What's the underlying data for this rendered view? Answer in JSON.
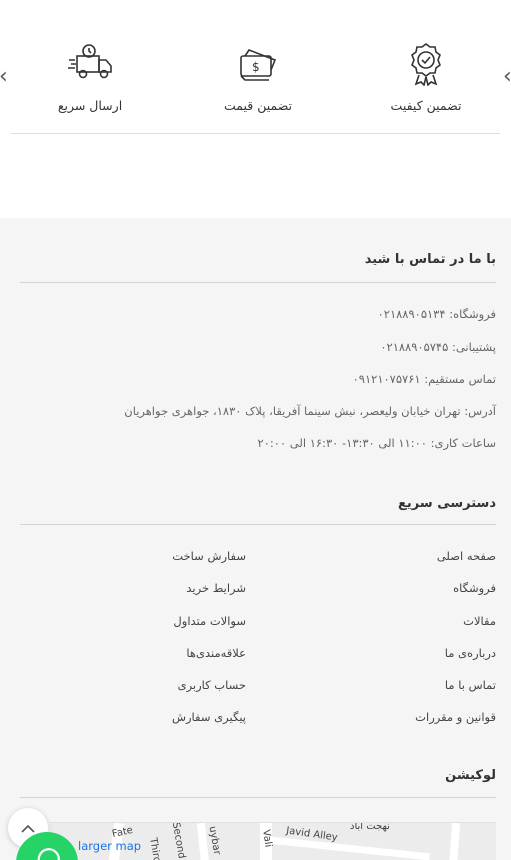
{
  "features": {
    "quality_label": "تضمین کیفیت",
    "price_label": "تضمین قیمت",
    "shipping_label": "ارسال سریع"
  },
  "contact": {
    "title": "با ما در تماس با شید",
    "shop": "فروشگاه: ۰۲۱۸۸۹۰۵۱۳۴",
    "support": "پشتیبانی: ۰۲۱۸۸۹۰۵۷۴۵",
    "direct": "تماس مستقیم: ۰۹۱۲۱۰۷۵۷۶۱",
    "address": "آدرس: تهران خیابان ولیعصر، نبش سینما آفریقا، پلاک ۱۸۳۰، جواهری جواهریان",
    "hours": "ساعات کاری: ۱۱:۰۰ الی ۱۳:۳۰- ۱۶:۳۰ الی ۲۰:۰۰"
  },
  "quick_access": {
    "title": "دسترسی سریع",
    "right_links": [
      "صفحه اصلی",
      "فروشگاه",
      "مقالات",
      "درباره‌ی ما",
      "تماس با ما",
      "قوانین و مقررات"
    ],
    "left_links": [
      "سفارش ساخت",
      "شرایط خرید",
      "سوالات متداول",
      "علاقه‌مندی‌ها",
      "حساب کاربری",
      "پیگیری سفارش"
    ]
  },
  "location": {
    "title": "لوکیشن",
    "map_link": "larger map",
    "labels": [
      "Fate",
      "Second",
      "uybar",
      "Vali",
      "Javid Alley",
      "نهجت اباد",
      "Third"
    ]
  },
  "icons": {
    "quality": "award-badge-icon",
    "price": "money-icon",
    "shipping": "delivery-truck-icon",
    "scroll_top": "chevron-up-icon",
    "whatsapp": "whatsapp-icon"
  },
  "colors": {
    "footer_bg": "#f5f5f5",
    "whatsapp": "#25d366",
    "link_blue": "#1a73e8"
  }
}
